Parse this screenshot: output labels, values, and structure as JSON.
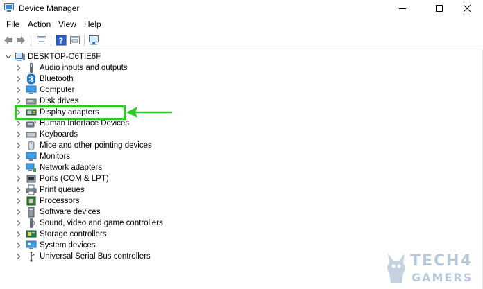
{
  "window": {
    "title": "Device Manager"
  },
  "menu": [
    "File",
    "Action",
    "View",
    "Help"
  ],
  "tree": {
    "root": "DESKTOP-O6TIE6F",
    "items": [
      {
        "label": "Audio inputs and outputs",
        "icon": "speaker-icon"
      },
      {
        "label": "Bluetooth",
        "icon": "bluetooth-icon"
      },
      {
        "label": "Computer",
        "icon": "computer-icon"
      },
      {
        "label": "Disk drives",
        "icon": "disk-drive-icon"
      },
      {
        "label": "Display adapters",
        "icon": "display-adapter-icon"
      },
      {
        "label": "Human Interface Devices",
        "icon": "hid-icon"
      },
      {
        "label": "Keyboards",
        "icon": "keyboard-icon"
      },
      {
        "label": "Mice and other pointing devices",
        "icon": "mouse-icon"
      },
      {
        "label": "Monitors",
        "icon": "monitor-icon"
      },
      {
        "label": "Network adapters",
        "icon": "network-adapter-icon"
      },
      {
        "label": "Ports (COM & LPT)",
        "icon": "port-icon"
      },
      {
        "label": "Print queues",
        "icon": "printer-icon"
      },
      {
        "label": "Processors",
        "icon": "processor-icon"
      },
      {
        "label": "Software devices",
        "icon": "software-device-icon"
      },
      {
        "label": "Sound, video and game controllers",
        "icon": "sound-controller-icon"
      },
      {
        "label": "Storage controllers",
        "icon": "storage-controller-icon"
      },
      {
        "label": "System devices",
        "icon": "system-device-icon"
      },
      {
        "label": "Universal Serial Bus controllers",
        "icon": "usb-icon"
      }
    ]
  },
  "annotation": {
    "highlight_color": "#2ec927",
    "highlighted_item": "Display adapters"
  },
  "watermark": {
    "line1": "TECH4",
    "line2": "GAMERS"
  }
}
